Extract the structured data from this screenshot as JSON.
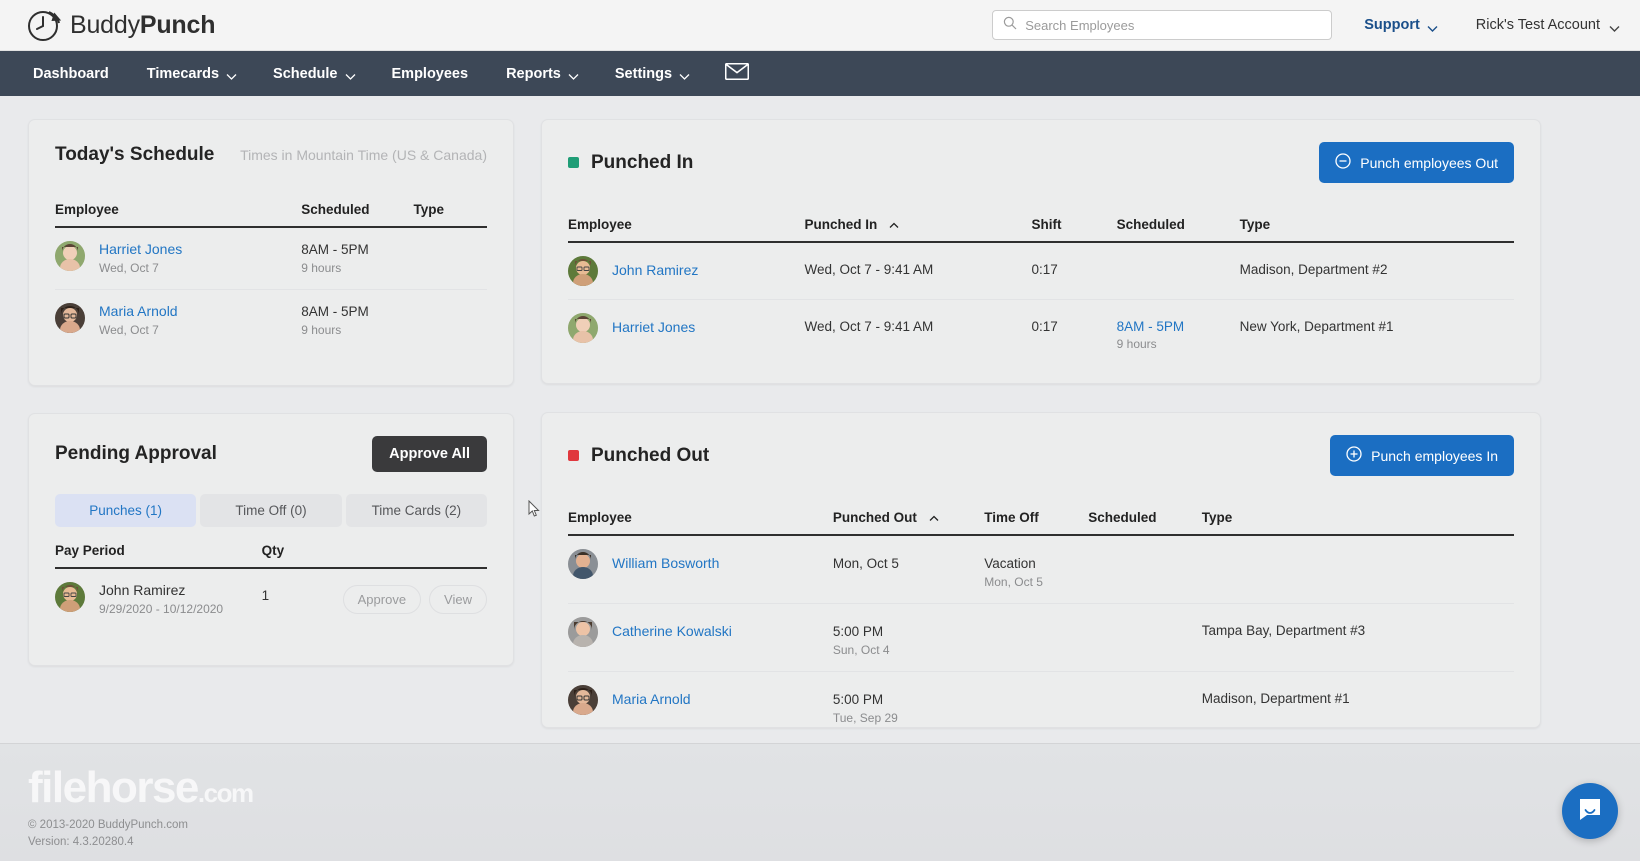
{
  "header": {
    "logo_text_light": "Buddy",
    "logo_text_bold": "Punch",
    "logo_icon": "clock-icon",
    "search": {
      "placeholder": "Search Employees",
      "value": "",
      "icon": "search-icon"
    },
    "support_label": "Support",
    "account_label": "Rick's Test Account",
    "caret_icon": "chevron-down-icon"
  },
  "nav": {
    "items": [
      {
        "label": "Dashboard",
        "has_caret": false,
        "active": true
      },
      {
        "label": "Timecards",
        "has_caret": true,
        "active": false
      },
      {
        "label": "Schedule",
        "has_caret": true,
        "active": false
      },
      {
        "label": "Employees",
        "has_caret": false,
        "active": false
      },
      {
        "label": "Reports",
        "has_caret": true,
        "active": false
      },
      {
        "label": "Settings",
        "has_caret": true,
        "active": false
      }
    ],
    "mail_icon": "envelope-icon"
  },
  "todays_schedule": {
    "title": "Today's Schedule",
    "timezone_note": "Times in Mountain Time (US & Canada)",
    "columns": [
      "Employee",
      "Scheduled",
      "Type"
    ],
    "rows": [
      {
        "name": "Harriet Jones",
        "sub": "Wed, Oct 7",
        "scheduled": "8AM - 5PM",
        "scheduled_sub": "9 hours",
        "type": ""
      },
      {
        "name": "Maria Arnold",
        "sub": "Wed, Oct 7",
        "scheduled": "8AM - 5PM",
        "scheduled_sub": "9 hours",
        "type": ""
      }
    ]
  },
  "pending_approval": {
    "title": "Pending Approval",
    "approve_all_label": "Approve All",
    "tabs": [
      {
        "label": "Punches (1)",
        "active": true
      },
      {
        "label": "Time Off (0)",
        "active": false
      },
      {
        "label": "Time Cards (2)",
        "active": false
      }
    ],
    "columns": [
      "Pay Period",
      "Qty",
      ""
    ],
    "rows": [
      {
        "name": "John Ramirez",
        "sub": "9/29/2020 - 10/12/2020",
        "qty": "1",
        "approve_label": "Approve",
        "view_label": "View"
      }
    ]
  },
  "punched_in": {
    "title": "Punched In",
    "dot_color": "#1f9d76",
    "button_label": "Punch employees Out",
    "button_icon": "minus-circle-icon",
    "columns": [
      "Employee",
      "Punched In",
      "Shift",
      "Scheduled",
      "Type"
    ],
    "sort_column": "Punched In",
    "sort_icon": "chevron-up-icon",
    "rows": [
      {
        "name": "John Ramirez",
        "punched_in": "Wed, Oct 7 - 9:41 AM",
        "shift": "0:17",
        "scheduled": "",
        "scheduled_sub": "",
        "type": "Madison, Department #2"
      },
      {
        "name": "Harriet Jones",
        "punched_in": "Wed, Oct 7 - 9:41 AM",
        "shift": "0:17",
        "scheduled": "8AM - 5PM",
        "scheduled_sub": "9 hours",
        "type": "New York, Department #1"
      }
    ]
  },
  "punched_out": {
    "title": "Punched Out",
    "dot_color": "#e0383e",
    "button_label": "Punch employees In",
    "button_icon": "plus-circle-icon",
    "columns": [
      "Employee",
      "Punched Out",
      "Time Off",
      "Scheduled",
      "Type"
    ],
    "sort_column": "Punched Out",
    "sort_icon": "chevron-up-icon",
    "rows": [
      {
        "name": "William Bosworth",
        "punched_out": "Mon, Oct 5",
        "punched_out_sub": "",
        "time_off": "Vacation",
        "time_off_sub": "Mon, Oct 5",
        "scheduled": "",
        "type": ""
      },
      {
        "name": "Catherine Kowalski",
        "punched_out": "5:00 PM",
        "punched_out_sub": "Sun, Oct 4",
        "time_off": "",
        "time_off_sub": "",
        "scheduled": "",
        "type": "Tampa Bay, Department #3"
      },
      {
        "name": "Maria Arnold",
        "punched_out": "5:00 PM",
        "punched_out_sub": "Tue, Sep 29",
        "time_off": "",
        "time_off_sub": "",
        "scheduled": "",
        "type": "Madison, Department #1"
      }
    ]
  },
  "footer": {
    "copyright": "© 2013-2020 BuddyPunch.com",
    "version": "Version: 4.3.20280.4"
  },
  "watermark": {
    "name": "filehorse",
    "domain": ".com"
  },
  "chat": {
    "icon": "chat-bubble-icon"
  },
  "colors": {
    "nav_bg": "#3d4857",
    "accent_blue": "#1b6ec2",
    "link_blue": "#2276c4",
    "dark_button": "#3a3a3c",
    "page_bg": "#e9eaec",
    "card_bg": "#eceded"
  }
}
